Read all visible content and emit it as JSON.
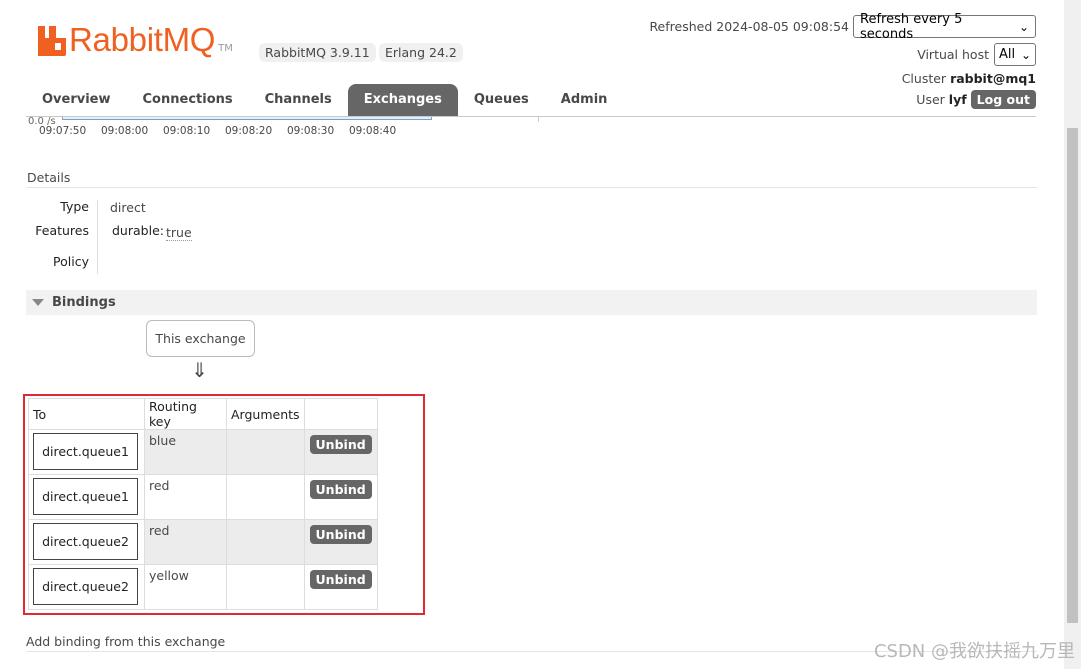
{
  "header": {
    "logo_text": "RabbitMQ",
    "logo_tm": "TM",
    "version": "RabbitMQ 3.9.11",
    "erlang": "Erlang 24.2",
    "refreshed": "Refreshed 2024-08-05 09:08:54",
    "refresh_select": "Refresh every 5 seconds",
    "vhost_label": "Virtual host",
    "vhost_select": "All",
    "cluster_label": "Cluster",
    "cluster_name": "rabbit@mq1",
    "user_label": "User",
    "user_name": "lyf",
    "logout_label": "Log out"
  },
  "tabs": [
    {
      "label": "Overview",
      "active": false
    },
    {
      "label": "Connections",
      "active": false
    },
    {
      "label": "Channels",
      "active": false
    },
    {
      "label": "Exchanges",
      "active": true
    },
    {
      "label": "Queues",
      "active": false
    },
    {
      "label": "Admin",
      "active": false
    }
  ],
  "chart": {
    "rate_label": "0.0 /s",
    "ticks": [
      "09:07:50",
      "09:08:00",
      "09:08:10",
      "09:08:20",
      "09:08:30",
      "09:08:40"
    ]
  },
  "details": {
    "heading": "Details",
    "type_label": "Type",
    "type_value": "direct",
    "features_label": "Features",
    "features_key": "durable:",
    "features_value": "true",
    "policy_label": "Policy"
  },
  "bindings": {
    "title": "Bindings",
    "this_exchange": "This exchange",
    "arrow": "⇓",
    "columns": [
      "To",
      "Routing key",
      "Arguments",
      ""
    ],
    "rows": [
      {
        "to": "direct.queue1",
        "routing_key": "blue",
        "arguments": "",
        "action": "Unbind"
      },
      {
        "to": "direct.queue1",
        "routing_key": "red",
        "arguments": "",
        "action": "Unbind"
      },
      {
        "to": "direct.queue2",
        "routing_key": "red",
        "arguments": "",
        "action": "Unbind"
      },
      {
        "to": "direct.queue2",
        "routing_key": "yellow",
        "arguments": "",
        "action": "Unbind"
      }
    ]
  },
  "add_binding": "Add binding from this exchange",
  "watermark": "CSDN @我欲扶摇九万里",
  "colors": {
    "brand": "#f06020",
    "tab_active": "#666666",
    "highlight_frame": "#dc2b35"
  }
}
